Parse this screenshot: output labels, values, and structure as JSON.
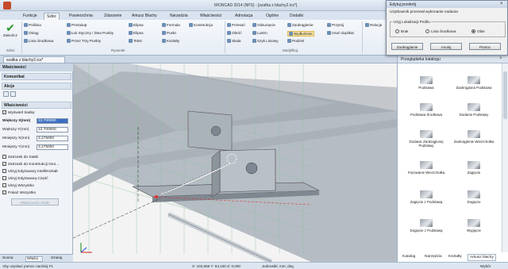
{
  "window": {
    "title": "IRONCAD 2014 (NPS) - [szafka z blachy2.ics*]"
  },
  "ribbon": {
    "tabs": [
      "Funkcje",
      "Szkic",
      "Powierzchnia",
      "Zdarzenie",
      "Arkusz Blachy",
      "Narzędzia",
      "Właściwości",
      "Adnotacja",
      "Ogólne",
      "Dodatki"
    ],
    "active_tab": "Szkic",
    "zakoncz": "Zakończ",
    "szkic_group": "Szkic",
    "col1": [
      "Polilinia",
      "Okrąg",
      "Linia Środkowa"
    ],
    "col2": [
      "Prostokąt",
      "Łuk Styczny / Dwa Punkty",
      "Przez Trzy Punkty"
    ],
    "col3": [
      "Elipsa",
      "Elipsa",
      "Tekst"
    ],
    "col4": [
      "Formuła",
      "Punkt",
      "Kształty"
    ],
    "col5": [
      "Konstrukcja"
    ],
    "rysunek_group": "Rysunek",
    "mod1": [
      "Przesuń",
      "Obróć",
      "Skala"
    ],
    "mod2": [
      "Odsunięcie",
      "Lustro",
      "Szyk Liniowy"
    ],
    "mod3": [
      "Zaokrąglenie",
      "Wydłużenie",
      "Podziel"
    ],
    "mod4": [
      "Przytnij",
      "Usuń duplikat"
    ],
    "modyfikuj_group": "Modyfikuj",
    "relacje": "Relacje"
  },
  "document_tab": "szafka z blachy2.ics*",
  "left_panel": {
    "title": "Właściwości",
    "komunikat": "Komunikat",
    "akcje": "Akcje",
    "wlasciwosci": "Właściwości",
    "show_grid": "Wyświetl Siatkę",
    "fields": [
      {
        "label": "Większy X(mm)",
        "value": "12,700000"
      },
      {
        "label": "Większy Y(mm)",
        "value": "12,700000"
      },
      {
        "label": "Mniejszy X(mm)",
        "value": "3,175000"
      },
      {
        "label": "Mniejszy Y(mm)",
        "value": "3,175000"
      }
    ],
    "checks": [
      {
        "label": "Zatrzask do Siatki",
        "checked": false
      },
      {
        "label": "Zatrzask do Konstrukcji Geo...",
        "checked": true
      },
      {
        "label": "Ukryj Edytowany IntelliKształt",
        "checked": false
      },
      {
        "label": "Ukryj Edytowaną Część",
        "checked": false
      },
      {
        "label": "Ukryj Wszystko",
        "checked": false
      },
      {
        "label": "Pokaż Wszystko",
        "checked": true
      }
    ],
    "button": "Właściwości siatki",
    "bottom_tabs": [
      "Scena",
      "Właści...",
      "Szukaj"
    ]
  },
  "catalog": {
    "title": "Przeglądarka katalogu",
    "items": [
      "Podstawa",
      "Zaokrąglona Podstawa",
      "Podstawa Środkowa",
      "Dodanie Podstawy",
      "Dodanie Zaokrąglonej Podstawy",
      "Zaokrąglenie Wierzchołka",
      "Fazowanie Wierzchołka",
      "Zagięcie",
      "Zagięcie z Podstawą",
      "Dogięcie",
      "Dogięcie z Podstawą",
      "Wygięcie"
    ],
    "tabs": [
      "Katalog",
      "Narzędzia",
      "Kształty",
      "Arkusz blachy"
    ],
    "active_tab": "Arkusz blachy"
  },
  "dialog": {
    "title": "Edytuj przekrój",
    "message": "Użytkownik przerwał wykonanie zadania",
    "group_label": "Użyj Lokalizacji Profilu",
    "radios": [
      "Brak",
      "Linia Środkowa",
      "Obie"
    ],
    "selected": "Obie",
    "buttons": [
      "Zaokrąglanie",
      "Anuluj",
      "Pomoc"
    ]
  },
  "status": {
    "left": "Aby uzyskać pomoc naciśnij F1",
    "coords": "X: 102,556 Y: 53,100 Z: 0,000",
    "units": "Jednostki: mm; deg",
    "right": "Wybór"
  }
}
